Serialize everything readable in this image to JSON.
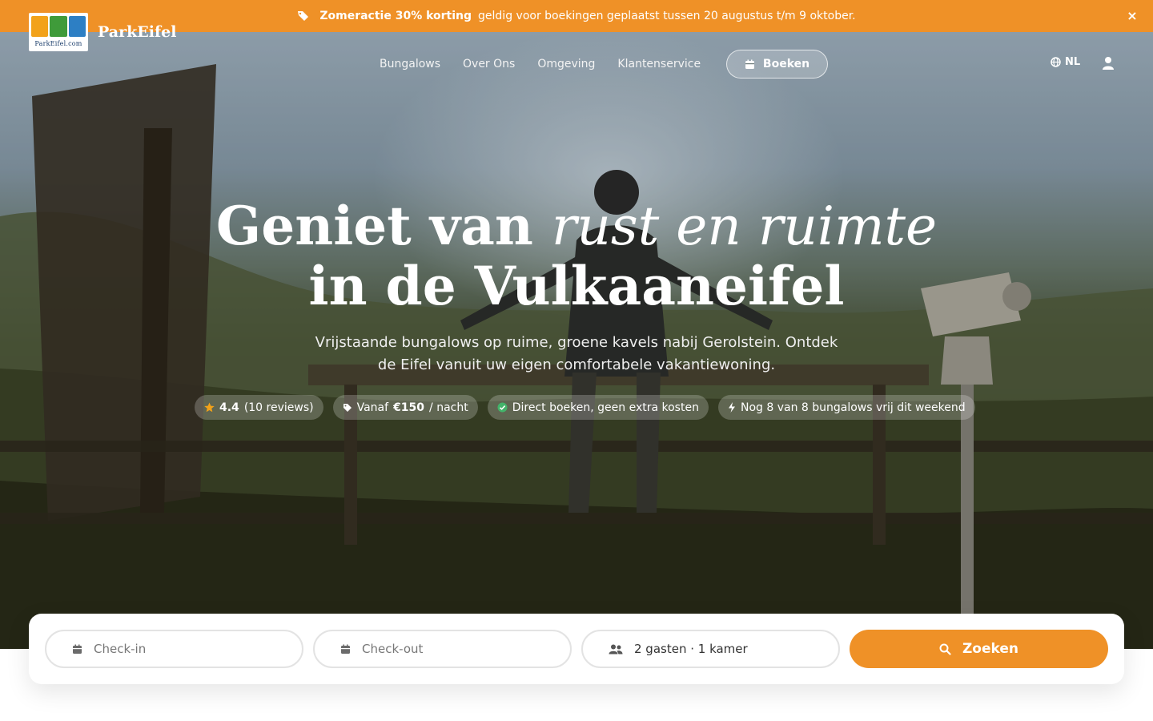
{
  "promo": {
    "strong": "Zomeractie 30% korting",
    "text": "geldig voor boekingen geplaatst tussen 20 augustus t/m 9 oktober.",
    "close": "×",
    "icon": "tag-icon"
  },
  "header": {
    "logo_caption": "ParkEifel.com",
    "brand": "ParkEifel",
    "nav": [
      "Bungalows",
      "Over Ons",
      "Omgeving",
      "Klantenservice"
    ],
    "book_label": "Boeken",
    "lang": "NL"
  },
  "hero": {
    "headline_part1": "Geniet van",
    "headline_italic": "rust en ruimte",
    "headline_line2": "in de Vulkaaneifel",
    "subtitle": "Vrijstaande bungalows op ruime, groene kavels nabij Gerolstein. Ontdek de Eifel vanuit uw eigen comfortabele vakantiewoning.",
    "rating": "4.4",
    "reviews": "(10 reviews)",
    "price_prefix": "Vanaf",
    "price": "€150",
    "price_suffix": "/ nacht",
    "booking_note": "Direct boeken, geen extra kosten",
    "availability": "Nog 8 van 8 bungalows vrij dit weekend"
  },
  "search": {
    "checkin": "Check-in",
    "checkout": "Check-out",
    "guests": "2 gasten · 1 kamer",
    "button": "Zoeken"
  },
  "colors": {
    "accent": "#ef9127",
    "logo_tiles": [
      "#f2a21a",
      "#3f9b3a",
      "#2d7fc4"
    ]
  }
}
